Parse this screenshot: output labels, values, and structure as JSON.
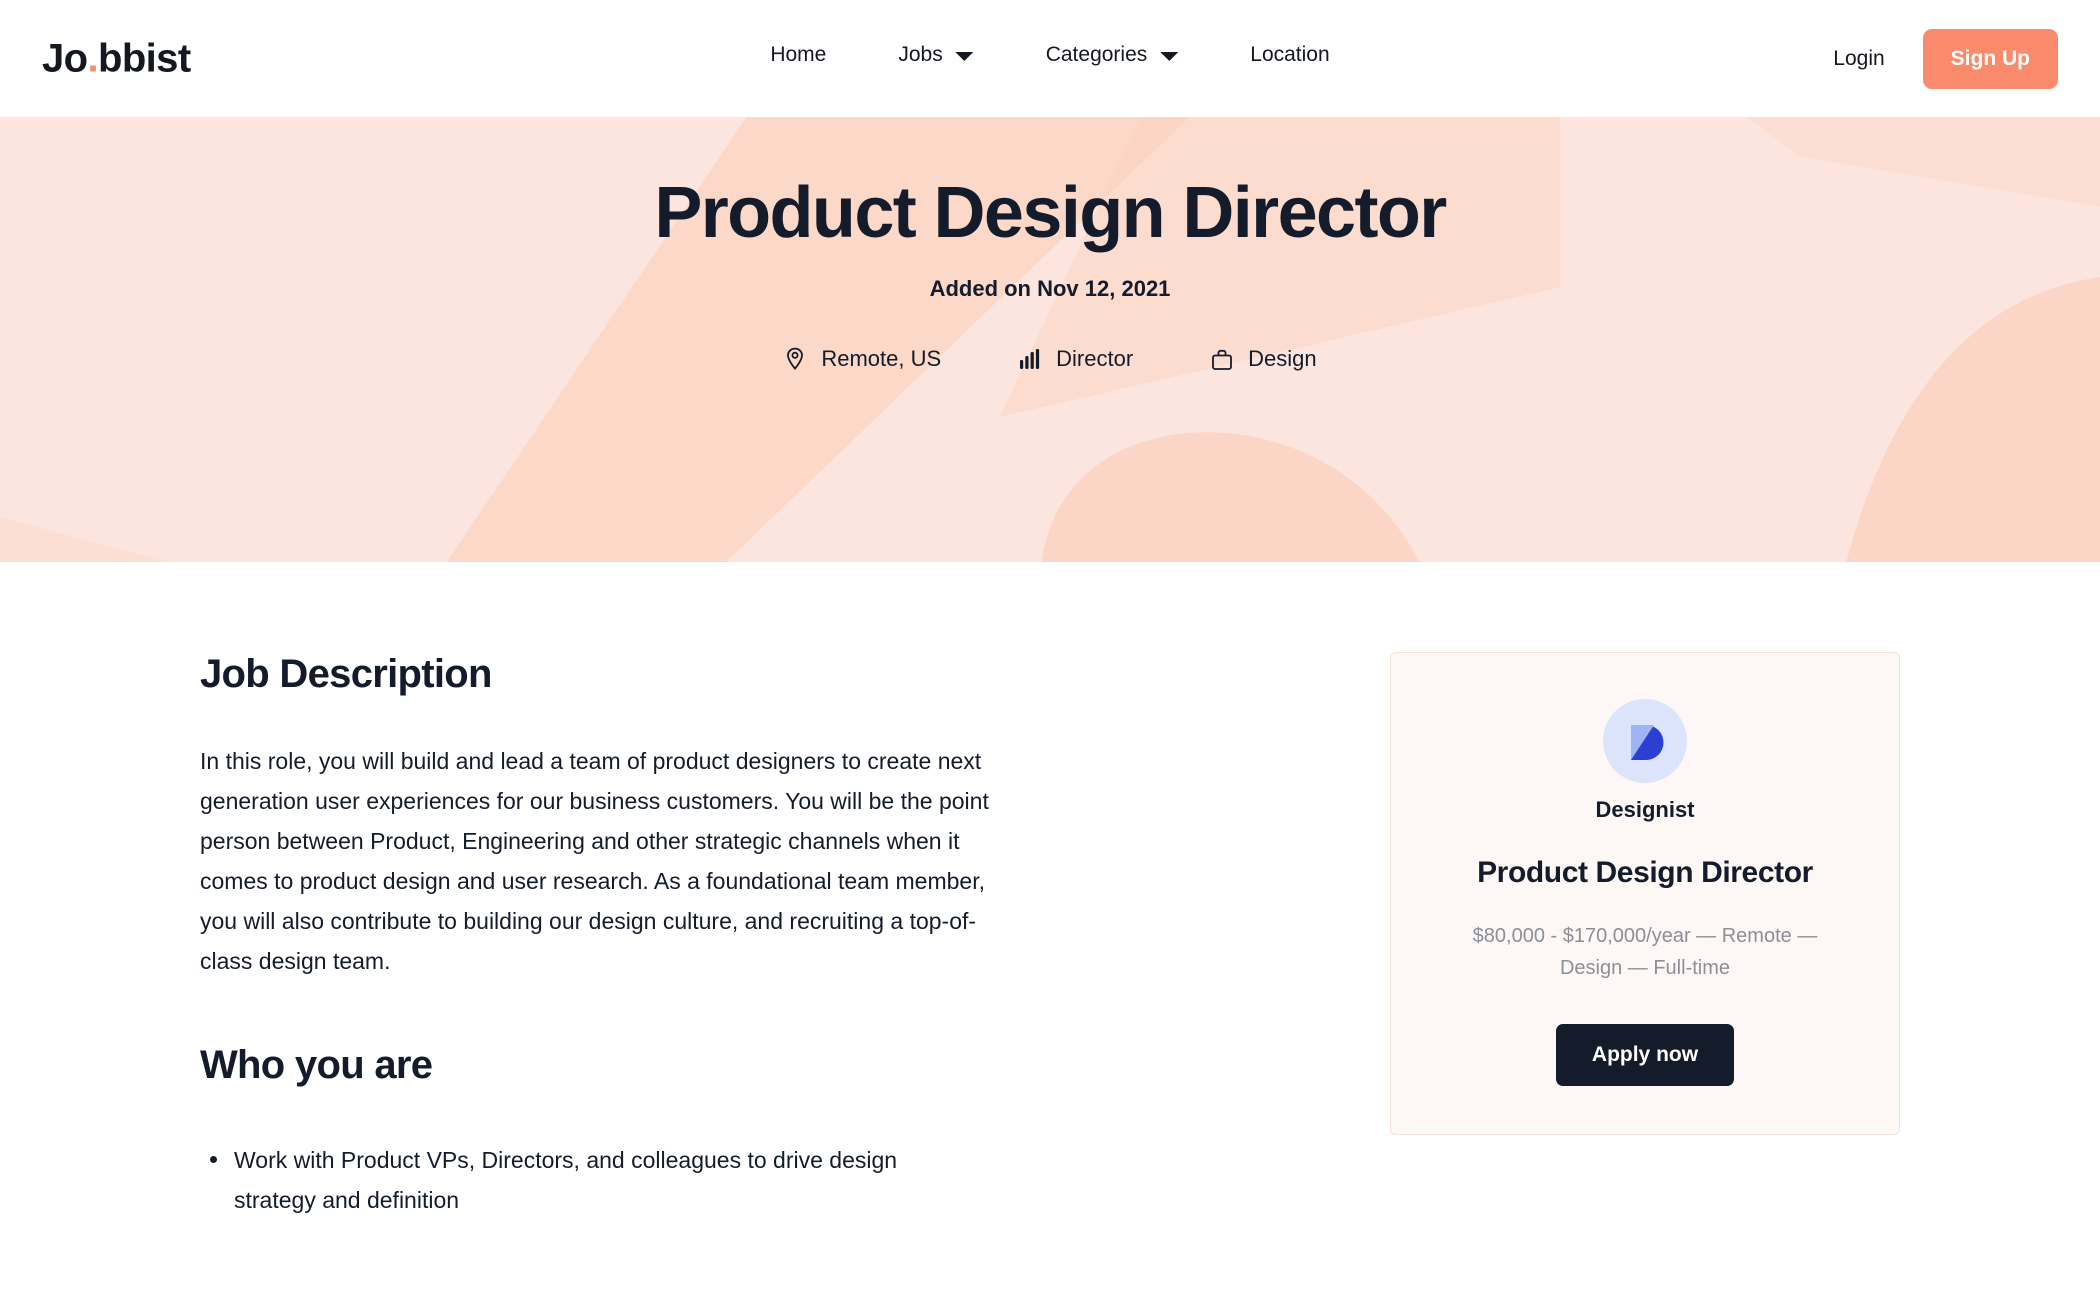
{
  "brand": {
    "name_start": "Jo",
    "dot": ".",
    "name_end": "bbist"
  },
  "nav": {
    "items": [
      {
        "label": "Home",
        "has_caret": false
      },
      {
        "label": "Jobs",
        "has_caret": true
      },
      {
        "label": "Categories",
        "has_caret": true
      },
      {
        "label": "Location",
        "has_caret": false
      }
    ],
    "login_label": "Login",
    "signup_label": "Sign Up"
  },
  "hero": {
    "title": "Product Design Director",
    "added_on": "Added on Nov 12, 2021",
    "meta": [
      {
        "icon": "map-pin-icon",
        "label": "Remote, US"
      },
      {
        "icon": "bar-chart-icon",
        "label": "Director"
      },
      {
        "icon": "briefcase-icon",
        "label": "Design"
      }
    ]
  },
  "description": {
    "heading": "Job Description",
    "paragraph": "In this role, you will build and lead a team of product designers to create next generation user experiences for our business customers. You will be the point person between Product, Engineering and other strategic channels when it comes to product design and user research. As a foundational team member, you will also contribute to building our design culture, and recruiting a top-of-class design team.",
    "who_heading": "Who you are",
    "who_bullets": [
      "Work with Product VPs, Directors, and colleagues to drive design strategy and definition"
    ]
  },
  "job_card": {
    "company": "Designist",
    "title": "Product Design Director",
    "meta": "$80,000 - $170,000/year — Remote — Design — Full-time",
    "apply_label": "Apply now"
  },
  "colors": {
    "accent": "#f98a6b",
    "hero_bg": "#fce5de",
    "hero_shape": "#fbd0bc",
    "ink": "#141c2b",
    "card_bg": "#fdf8f6",
    "card_border": "#f6e2da",
    "muted": "#8b8f98",
    "logo_circle": "#dbe4fb",
    "logo_dark": "#2d3fd0",
    "logo_light": "#9eb4f7"
  }
}
